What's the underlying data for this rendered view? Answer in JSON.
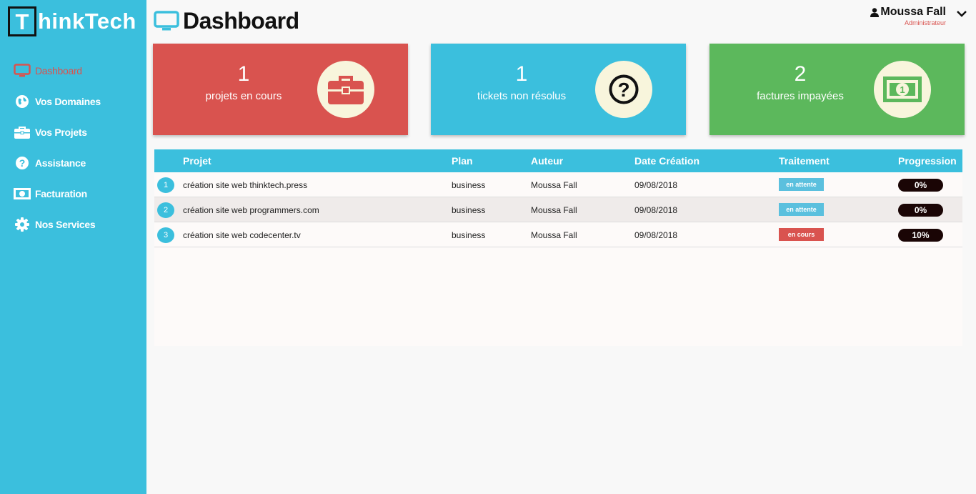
{
  "brand": {
    "logo_letter": "T",
    "logo_rest": "hinkTech"
  },
  "sidebar": {
    "items": [
      {
        "label": "Dashboard",
        "icon": "monitor-icon",
        "active": true
      },
      {
        "label": "Vos Domaines",
        "icon": "globe-icon"
      },
      {
        "label": "Vos Projets",
        "icon": "briefcase-icon"
      },
      {
        "label": "Assistance",
        "icon": "question-circle-icon"
      },
      {
        "label": "Facturation",
        "icon": "money-icon"
      },
      {
        "label": "Nos Services",
        "icon": "gear-icon"
      }
    ]
  },
  "header": {
    "title": "Dashboard",
    "title_icon": "monitor-icon"
  },
  "user": {
    "name": "Moussa Fall",
    "role": "Administrateur",
    "icon": "user-icon",
    "menu_icon": "chevron-down-icon"
  },
  "cards": [
    {
      "number": "1",
      "label": "projets en cours",
      "icon": "briefcase-icon",
      "color": "#d9534f"
    },
    {
      "number": "1",
      "label": "tickets non résolus",
      "icon": "question-circle-icon",
      "color": "#3bbfdd"
    },
    {
      "number": "2",
      "label": "factures impayées",
      "icon": "money-icon",
      "color": "#5cb85c"
    }
  ],
  "table": {
    "headers": [
      "Projet",
      "Plan",
      "Auteur",
      "Date Création",
      "Traitement",
      "Progression"
    ],
    "rows": [
      {
        "index": "1",
        "projet": "création site web thinktech.press",
        "plan": "business",
        "auteur": "Moussa Fall",
        "date": "09/08/2018",
        "traitement": "en attente",
        "traitement_color": "#5bc0de",
        "progression": "0%"
      },
      {
        "index": "2",
        "projet": "création site web programmers.com",
        "plan": "business",
        "auteur": "Moussa Fall",
        "date": "09/08/2018",
        "traitement": "en attente",
        "traitement_color": "#5bc0de",
        "progression": "0%"
      },
      {
        "index": "3",
        "projet": "création site web codecenter.tv",
        "plan": "business",
        "auteur": "Moussa Fall",
        "date": "09/08/2018",
        "traitement": "en cours",
        "traitement_color": "#d9534f",
        "progression": "10%"
      }
    ]
  },
  "colors": {
    "accent": "#3bbfdd",
    "danger": "#d9534f",
    "success": "#5cb85c",
    "icon_circle": "#f8f5dc"
  }
}
